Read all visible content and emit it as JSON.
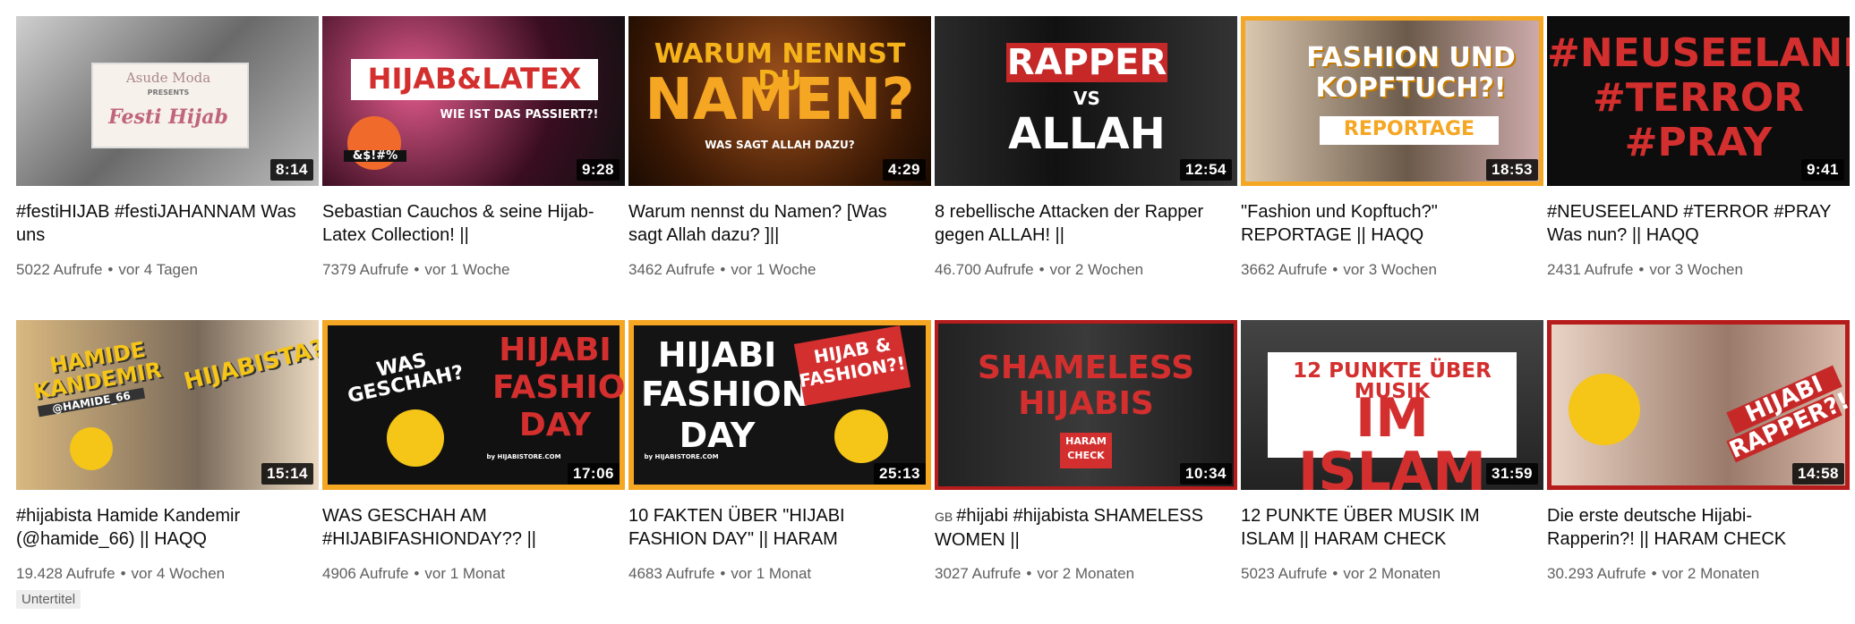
{
  "videos": [
    {
      "title": "#festiHIJAB #festiJAHANNAM Was uns",
      "views": "5022 Aufrufe",
      "age": "vor 4 Tagen",
      "duration": "8:14",
      "thumb_text": [
        "Asude Moda",
        "PRESENTS",
        "Festi Hijab"
      ]
    },
    {
      "title": "Sebastian Cauchos & seine Hijab-Latex Collection! ||",
      "views": "7379 Aufrufe",
      "age": "vor 1 Woche",
      "duration": "9:28",
      "thumb_text": [
        "HIJAB&LATEX",
        "WIE IST DAS PASSIERT?!",
        "&$!#%"
      ]
    },
    {
      "title": "Warum nennst du Namen? [Was sagt Allah dazu? ]||",
      "views": "3462 Aufrufe",
      "age": "vor 1 Woche",
      "duration": "4:29",
      "thumb_text": [
        "WARUM NENNST DU",
        "NAMEN?",
        "WAS SAGT ALLAH DAZU?"
      ]
    },
    {
      "title": "8 rebellische Attacken der Rapper gegen ALLAH! ||",
      "views": "46.700 Aufrufe",
      "age": "vor 2 Wochen",
      "duration": "12:54",
      "thumb_text": [
        "RAPPER",
        "VS",
        "ALLAH"
      ]
    },
    {
      "title": "\"Fashion und Kopftuch?\" REPORTAGE || HAQQ",
      "views": "3662 Aufrufe",
      "age": "vor 3 Wochen",
      "duration": "18:53",
      "thumb_text": [
        "FASHION UND",
        "KOPFTUCH?!",
        "REPORTAGE"
      ]
    },
    {
      "title": "#NEUSEELAND #TERROR #PRAY Was nun? || HAQQ",
      "views": "2431 Aufrufe",
      "age": "vor 3 Wochen",
      "duration": "9:41",
      "thumb_text": [
        "#NEUSEELAND",
        "#TERROR",
        "#PRAY"
      ]
    },
    {
      "title": "#hijabista Hamide Kandemir (@hamide_66) || HAQQ",
      "views": "19.428 Aufrufe",
      "age": "vor 4 Wochen",
      "duration": "15:14",
      "badge": "Untertitel",
      "thumb_text": [
        "HAMIDE",
        "KANDEMIR",
        "@HAMIDE_66",
        "HIJABISTA?!"
      ]
    },
    {
      "title": "WAS GESCHAH AM #HIJABIFASHIONDAY?? ||",
      "views": "4906 Aufrufe",
      "age": "vor 1 Monat",
      "duration": "17:06",
      "thumb_text": [
        "WAS GESCHAH?",
        "HIJABI",
        "FASHION",
        "DAY",
        "by HIJABISTORE.COM"
      ]
    },
    {
      "title": "10 FAKTEN ÜBER \"HIJABI FASHION DAY\" || HARAM",
      "views": "4683 Aufrufe",
      "age": "vor 1 Monat",
      "duration": "25:13",
      "thumb_text": [
        "HIJABI",
        "FASHION",
        "DAY",
        "HIJAB &",
        "FASHION?!",
        "by HIJABISTORE.COM"
      ]
    },
    {
      "title": "#hijabi #hijabista SHAMELESS WOMEN ||",
      "title_prefix": "GB",
      "views": "3027 Aufrufe",
      "age": "vor 2 Monaten",
      "duration": "10:34",
      "thumb_text": [
        "SHAMELESS",
        "HIJABIS",
        "HARAM",
        "CHECK"
      ]
    },
    {
      "title": "12 PUNKTE ÜBER MUSIK IM ISLAM || HARAM CHECK",
      "views": "5023 Aufrufe",
      "age": "vor 2 Monaten",
      "duration": "31:59",
      "thumb_text": [
        "12 PUNKTE ÜBER MUSIK",
        "IM ISLAM"
      ]
    },
    {
      "title": "Die erste deutsche Hijabi-Rapperin?! || HARAM CHECK",
      "views": "30.293 Aufrufe",
      "age": "vor 2 Monaten",
      "duration": "14:58",
      "thumb_text": [
        "HIJABI",
        "RAPPER?!"
      ]
    }
  ],
  "separator": "•",
  "colors": {
    "title": "#0d0d0d",
    "meta": "#606060",
    "accent_red": "#d32f2f",
    "accent_yellow": "#f5c518",
    "accent_orange": "#f5a623"
  }
}
